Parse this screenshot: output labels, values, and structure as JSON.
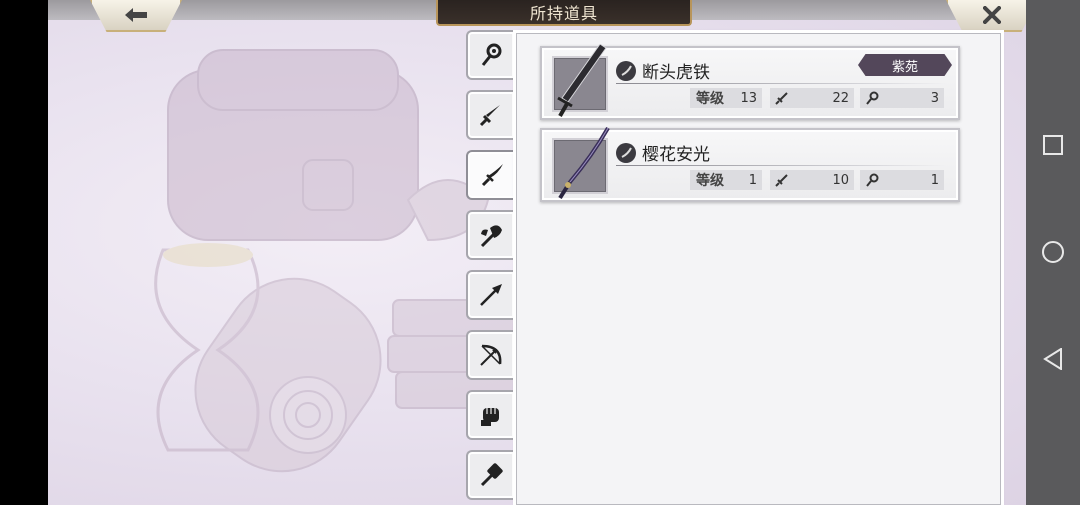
{
  "header": {
    "title": "所持道具",
    "back_icon": "arrow-left-icon",
    "close_icon": "close-icon"
  },
  "tabs": [
    {
      "icon": "staff-icon"
    },
    {
      "icon": "sword-icon"
    },
    {
      "icon": "katana-icon",
      "active": true
    },
    {
      "icon": "axe-icon"
    },
    {
      "icon": "spear-icon"
    },
    {
      "icon": "bow-icon"
    },
    {
      "icon": "fist-icon"
    },
    {
      "icon": "hammer-icon"
    }
  ],
  "items": [
    {
      "name": "断头虎铁",
      "badge": "紫苑",
      "level_label": "等级",
      "level": "13",
      "attack": "22",
      "magic": "3"
    },
    {
      "name": "樱花安光",
      "level_label": "等级",
      "level": "1",
      "attack": "10",
      "magic": "1"
    }
  ],
  "colors": {
    "badge": "#53475a",
    "title_plate": "#2a2320",
    "gold_border": "#b8955a",
    "android_nav": "#5a5a5c"
  }
}
